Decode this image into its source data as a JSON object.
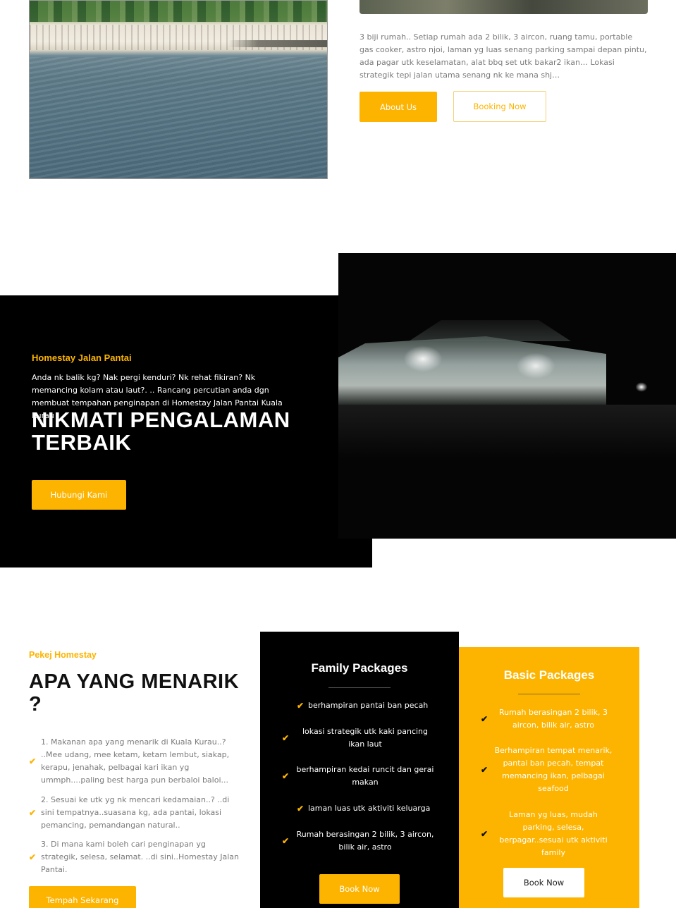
{
  "intro": {
    "text": "3 biji rumah.. Setiap rumah ada 2 bilik, 3 aircon, ruang tamu, portable gas cooker, astro njoi, laman yg luas senang parking sampai depan pintu, ada pagar utk keselamatan, alat bbq set utk bakar2 ikan… Lokasi strategik tepi jalan utama senang nk ke mana shj…",
    "about_label": "About Us",
    "booking_label": "Booking Now"
  },
  "homestay": {
    "subtitle": "Homestay Jalan Pantai",
    "text": "Anda nk balik kg? Nak pergi kenduri? Nk rehat fikiran? Nk memancing kolam atau laut?. .. Rancang percutian anda dgn membuat tempahan penginapan di Homestay Jalan Pantai Kuala Kurau",
    "title": "NIKMATI PENGALAMAN TERBAIK",
    "button_label": "Hubungi Kami"
  },
  "packages": {
    "subtitle": "Pekej Homestay",
    "title": "APA YANG MENARIK ?",
    "items": [
      "1. Makanan apa yang menarik di Kuala Kurau..? ..Mee udang, mee ketam, ketam lembut, siakap, kerapu, jenahak, pelbagai kari ikan yg ummph....paling best harga pun berbaloi baloi...",
      "2. Sesuai ke utk yg nk mencari kedamaian..? ..di sini tempatnya..suasana kg, ada pantai, lokasi pemancing, pemandangan natural..",
      "3. Di mana kami boleh cari penginapan yg strategik, selesa, selamat. ..di sini..Homestay Jalan Pantai."
    ],
    "button_label": "Tempah Sekarang"
  },
  "family_card": {
    "title": "Family Packages",
    "features": [
      "berhampiran pantai ban pecah",
      "lokasi strategik utk kaki pancing ikan laut",
      "berhampiran kedai runcit dan gerai makan",
      "laman luas utk aktiviti keluarga",
      "Rumah berasingan 2 bilik, 3 aircon, bilik air, astro"
    ],
    "button_label": "Book Now"
  },
  "basic_card": {
    "title": "Basic Packages",
    "features": [
      "Rumah berasingan 2 bilik, 3 aircon, bilik air, astro",
      "Berhampiran tempat menarik, pantai ban pecah, tempat memancing ikan, pelbagai seafood",
      "Laman yg luas, mudah parking, selesa, berpagar..sesuai utk aktiviti family"
    ],
    "button_label": "Book Now"
  },
  "colors": {
    "accent": "#fcb400",
    "dark": "#000000",
    "muted_text": "#7a7a7a"
  },
  "icons": {
    "check": "check-icon"
  }
}
